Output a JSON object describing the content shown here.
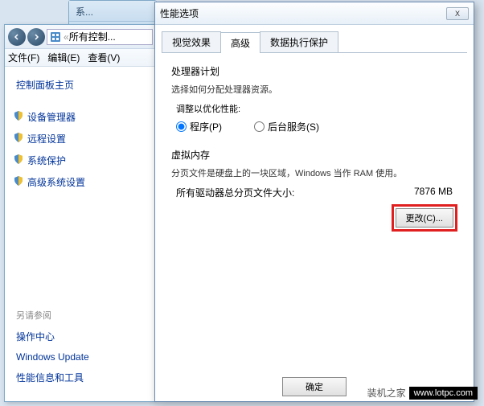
{
  "explorer": {
    "breadcrumb_icon": "control-panel",
    "breadcrumb": "所有控制...",
    "menu": {
      "file": "文件(F)",
      "edit": "编辑(E)",
      "view": "查看(V)"
    },
    "bg_title": "系..."
  },
  "sidebar": {
    "home": "控制面板主页",
    "items": [
      {
        "icon": "shield",
        "label": "设备管理器"
      },
      {
        "icon": "shield",
        "label": "远程设置"
      },
      {
        "icon": "shield",
        "label": "系统保护"
      },
      {
        "icon": "shield",
        "label": "高级系统设置"
      }
    ],
    "see_also": "另请参阅",
    "links": [
      "操作中心",
      "Windows Update",
      "性能信息和工具"
    ]
  },
  "dialog": {
    "title": "性能选项",
    "close": "X",
    "tabs": [
      "视觉效果",
      "高级",
      "数据执行保护"
    ],
    "active_tab": 1,
    "sched": {
      "title": "处理器计划",
      "desc": "选择如何分配处理器资源。",
      "sub": "调整以优化性能:",
      "opt1": "程序(P)",
      "opt2": "后台服务(S)"
    },
    "vm": {
      "title": "虚拟内存",
      "desc": "分页文件是硬盘上的一块区域，Windows 当作 RAM 使用。",
      "row_label": "所有驱动器总分页文件大小:",
      "row_value": "7876 MB",
      "change": "更改(C)..."
    },
    "ok": "确定"
  },
  "watermark": {
    "a": "装机之家",
    "b": "www.lotpc.com"
  }
}
